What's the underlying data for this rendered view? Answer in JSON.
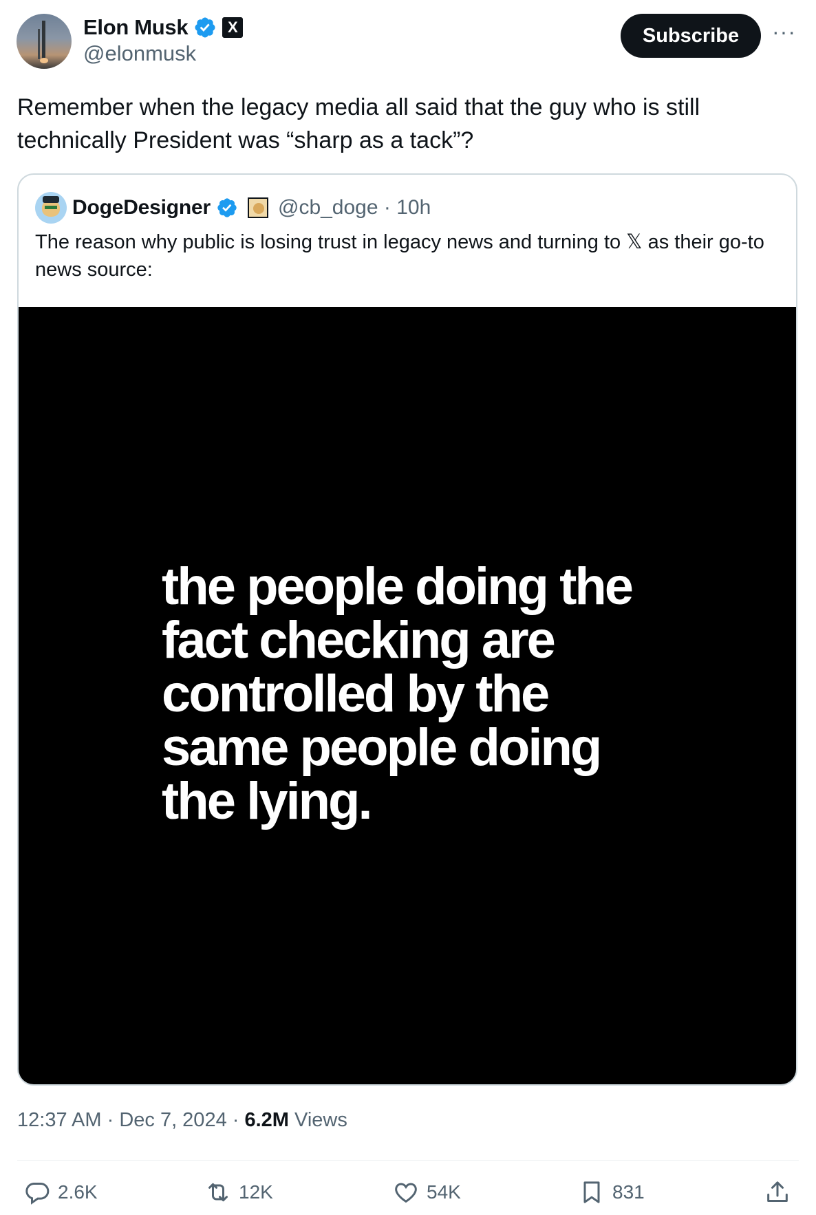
{
  "author": {
    "name": "Elon Musk",
    "handle": "@elonmusk",
    "badge_letter": "X"
  },
  "subscribe_label": "Subscribe",
  "more_label": "···",
  "post_text": "Remember when the legacy media all said that the guy who is still technically President was “sharp as a tack”?",
  "quoted": {
    "name": "DogeDesigner",
    "handle_time": "@cb_doge · 10h",
    "text": "The reason why public is losing trust in legacy news and turning to 𝕏 as their go-to news source:",
    "media_text": "the people doing the fact checking are controlled by the same people doing the lying."
  },
  "meta": {
    "time": "12:37 AM",
    "sep1": " · ",
    "date": "Dec 7, 2024",
    "sep2": " · ",
    "views_count": "6.2M",
    "views_label": " Views"
  },
  "actions": {
    "replies": "2.6K",
    "reposts": "12K",
    "likes": "54K",
    "bookmarks": "831"
  },
  "colors": {
    "text": "#0f1419",
    "secondary": "#536471",
    "verified": "#1d9bf0",
    "border": "#cfd9de"
  },
  "icons": [
    "verified-icon",
    "x-badge-icon",
    "more-icon",
    "reply-icon",
    "repost-icon",
    "like-icon",
    "bookmark-icon",
    "share-icon"
  ]
}
